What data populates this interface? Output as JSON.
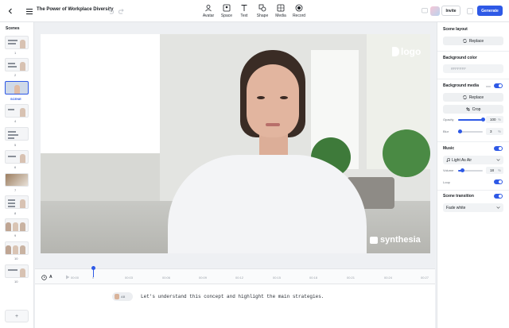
{
  "header": {
    "title": "The Power of Workplace Diversity",
    "tools": [
      "Avatar",
      "Space",
      "Text",
      "Shape",
      "Media",
      "Record"
    ],
    "invite_label": "Invite",
    "generate_label": "Generate"
  },
  "scenes": {
    "title": "Scenes",
    "selected_label": "SCENE",
    "numbers": [
      "1",
      "2",
      "3",
      "4",
      "5",
      "6",
      "7",
      "8",
      "9",
      "10"
    ],
    "add_label": "+"
  },
  "canvas": {
    "logo_text": "logo",
    "watermark_text": "synthesia"
  },
  "timeline": {
    "ticks": [
      "00:00",
      "0",
      "00:03",
      "00:06",
      "00:09",
      "00:12",
      "00:15",
      "00:18",
      "00:21",
      "00:24",
      "00:27",
      "00:30"
    ],
    "text_icon_label": "A"
  },
  "script": {
    "text": "Let's understand this concept and highlight the main strategies.",
    "avatar_tag": "AB"
  },
  "right_panel": {
    "scene_layout_title": "Scene layout",
    "replace_label": "Replace",
    "background_color_title": "Background color",
    "background_color_value": "#FFFFFF",
    "background_media_title": "Background media",
    "media_replace_label": "Replace",
    "crop_label": "Crop",
    "opacity_label": "Opacity",
    "opacity_value": "100",
    "blur_label": "Blur",
    "blur_value": "3",
    "percent_sign": "%",
    "music_title": "Music",
    "music_track": "Light As Air",
    "volume_label": "Volume",
    "volume_value": "18",
    "loop_label": "Loop",
    "scene_transition_title": "Scene transition",
    "transition_value": "Fade white"
  },
  "colors": {
    "accent": "#2e59e6",
    "panel_bg": "#ffffff",
    "app_bg": "#eef0f3"
  },
  "levels": {
    "opacity_fraction": 1.0,
    "blur_fraction": 0.03,
    "volume_fraction": 0.18
  }
}
